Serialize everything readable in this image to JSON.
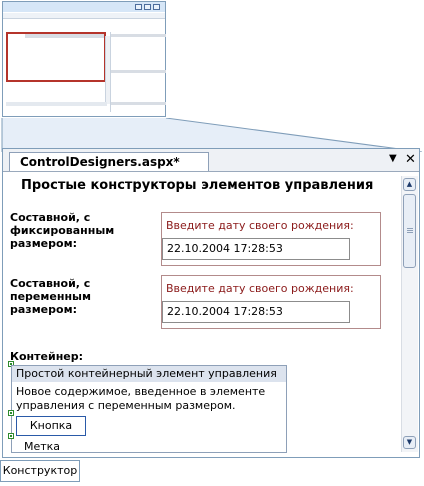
{
  "document_tab": {
    "title": "ControlDesigners.aspx*",
    "dropdown_icon": "triangle-down-icon",
    "close_icon": "close-icon"
  },
  "page": {
    "heading": "Простые конструкторы элементов управления",
    "fixed": {
      "label_line1": "Составной, с",
      "label_line2": "фиксированным",
      "label_line3": "размером:",
      "prompt": "Введите дату своего рождения:",
      "value": "22.10.2004 17:28:53"
    },
    "variable": {
      "label_line1": "Составной, с",
      "label_line2": "переменным",
      "label_line3": "размером:",
      "prompt": "Введите дату своего рождения:",
      "value": "22.10.2004 17:28:53"
    },
    "container": {
      "label": "Контейнер:",
      "header": "Простой контейнерный элемент управления",
      "content_line1": "Новое содержимое, введенное в элементе",
      "content_line2": "управления с переменным размером.",
      "button": "Кнопка",
      "label_control": "Метка"
    }
  },
  "bottom_tabs": {
    "designer": "Конструктор"
  },
  "colors": {
    "accent": "#b5342b",
    "prompt": "#8b1a1a",
    "border": "#7f9db9"
  }
}
